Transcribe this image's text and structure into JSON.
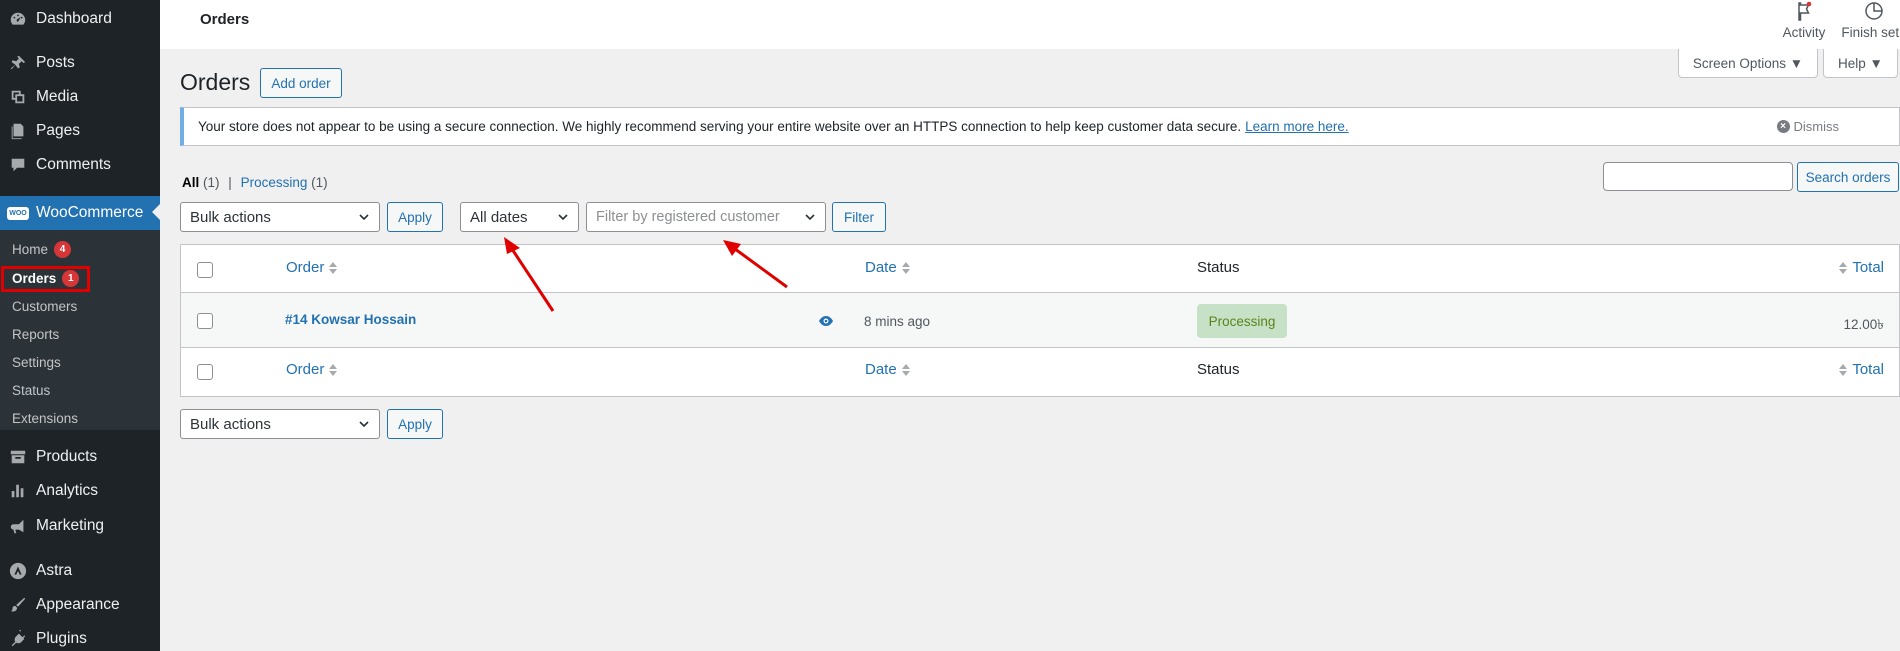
{
  "sidebar": {
    "items": [
      {
        "label": "Dashboard",
        "icon": "dashboard-icon"
      },
      {
        "label": "Posts",
        "icon": "pin-icon"
      },
      {
        "label": "Media",
        "icon": "media-icon"
      },
      {
        "label": "Pages",
        "icon": "pages-icon"
      },
      {
        "label": "Comments",
        "icon": "comment-icon"
      },
      {
        "label": "WooCommerce",
        "icon": "woo-icon"
      },
      {
        "label": "Products",
        "icon": "archive-icon"
      },
      {
        "label": "Analytics",
        "icon": "bar-chart-icon"
      },
      {
        "label": "Marketing",
        "icon": "megaphone-icon"
      },
      {
        "label": "Astra",
        "icon": "astra-icon"
      },
      {
        "label": "Appearance",
        "icon": "brush-icon"
      },
      {
        "label": "Plugins",
        "icon": "plug-icon"
      }
    ],
    "woo_logo_text": "WOO",
    "submenu": [
      {
        "label": "Home",
        "badge": "4"
      },
      {
        "label": "Orders",
        "badge": "1"
      },
      {
        "label": "Customers"
      },
      {
        "label": "Reports"
      },
      {
        "label": "Settings"
      },
      {
        "label": "Status"
      },
      {
        "label": "Extensions"
      }
    ]
  },
  "topbar": {
    "page_name": "Orders",
    "activity_label": "Activity",
    "finish_setup_label": "Finish setu"
  },
  "tabs": {
    "screen_options": "Screen Options ▼",
    "help": "Help ▼"
  },
  "heading": {
    "title": "Orders",
    "add_order": "Add order"
  },
  "notice": {
    "text": "Your store does not appear to be using a secure connection. We highly recommend serving your entire website over an HTTPS connection to help keep customer data secure.",
    "link": "Learn more here.",
    "dismiss": "Dismiss",
    "accent": "#72aee6"
  },
  "filters": {
    "all_label": "All",
    "all_count": "(1)",
    "separator": "|",
    "processing_label": "Processing",
    "processing_count": "(1)",
    "search_value": "",
    "search_button": "Search orders",
    "bulk_actions": "Bulk actions",
    "apply": "Apply",
    "dates": "All dates",
    "customer_placeholder": "Filter by registered customer",
    "filter_button": "Filter"
  },
  "table": {
    "columns": {
      "order": "Order",
      "date": "Date",
      "status": "Status",
      "total": "Total"
    },
    "rows": [
      {
        "order": "#14 Kowsar Hossain",
        "date": "8 mins ago",
        "status": "Processing",
        "total": "12.00৳"
      }
    ]
  },
  "bottom": {
    "bulk_actions": "Bulk actions",
    "apply": "Apply"
  },
  "colors": {
    "sidebar_bg": "#1d2327",
    "primary": "#2271b1",
    "status_processing_bg": "#c6e1c6",
    "status_processing_text": "#5b841b",
    "annotation": "#e00000"
  }
}
